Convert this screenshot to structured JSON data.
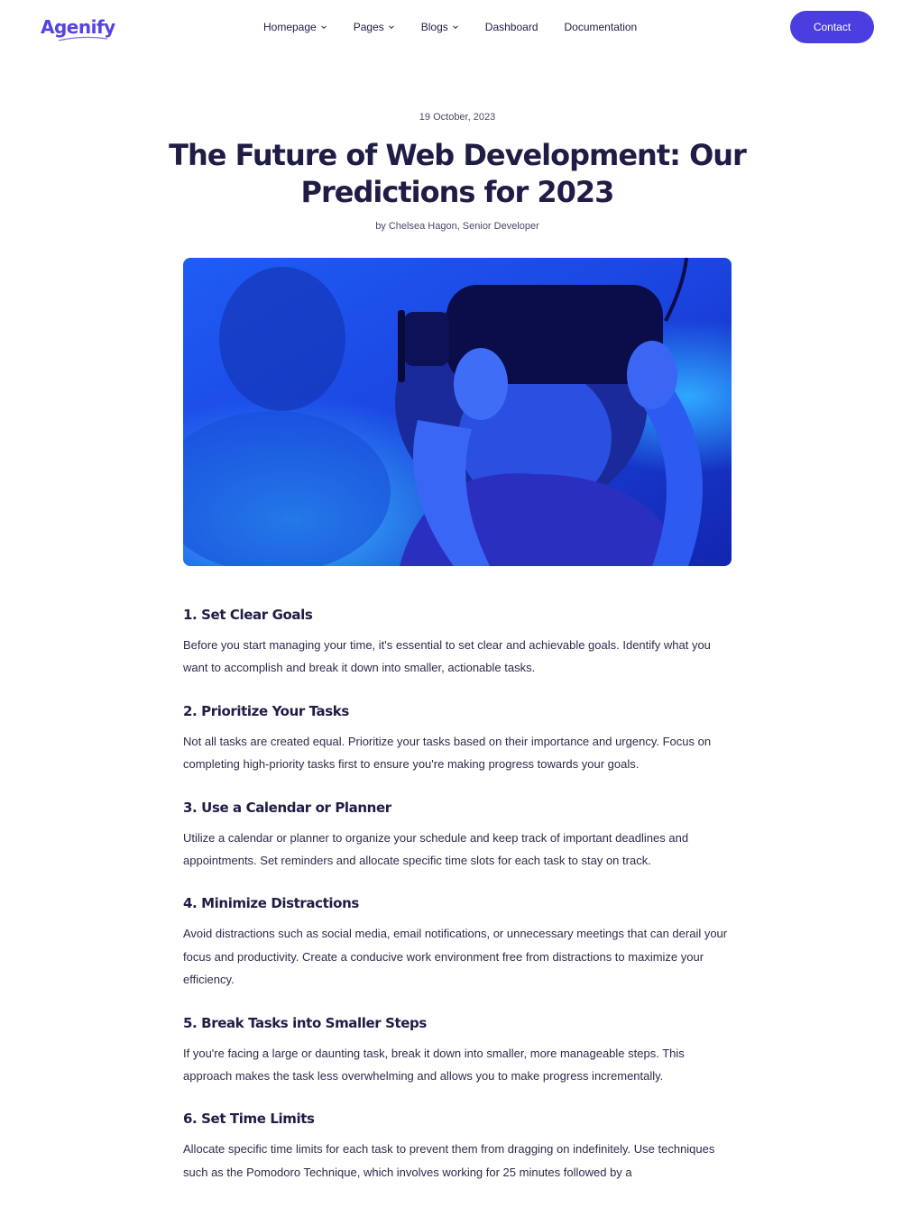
{
  "brand": {
    "name": "Agenify",
    "color": "#5444e3"
  },
  "nav": {
    "items": [
      {
        "label": "Homepage",
        "dropdown": true
      },
      {
        "label": "Pages",
        "dropdown": true
      },
      {
        "label": "Blogs",
        "dropdown": true
      },
      {
        "label": "Dashboard",
        "dropdown": false
      },
      {
        "label": "Documentation",
        "dropdown": false
      }
    ],
    "contact_label": "Contact"
  },
  "post": {
    "date": "19 October, 2023",
    "title": "The Future of Web Development: Our Predictions for 2023",
    "byline": "by Chelsea Hagon, Senior Developer",
    "sections": [
      {
        "heading": "1. Set Clear Goals",
        "body": "Before you start managing your time, it's essential to set clear and achievable goals. Identify what you want to accomplish and break it down into smaller, actionable tasks."
      },
      {
        "heading": "2. Prioritize Your Tasks",
        "body": "Not all tasks are created equal. Prioritize your tasks based on their importance and urgency. Focus on completing high-priority tasks first to ensure you're making progress towards your goals."
      },
      {
        "heading": "3. Use a Calendar or Planner",
        "body": "Utilize a calendar or planner to organize your schedule and keep track of important deadlines and appointments. Set reminders and allocate specific time slots for each task to stay on track."
      },
      {
        "heading": "4. Minimize Distractions",
        "body": "Avoid distractions such as social media, email notifications, or unnecessary meetings that can derail your focus and productivity. Create a conducive work environment free from distractions to maximize your efficiency."
      },
      {
        "heading": "5. Break Tasks into Smaller Steps",
        "body": "If you're facing a large or daunting task, break it down into smaller, more manageable steps. This approach makes the task less overwhelming and allows you to make progress incrementally."
      },
      {
        "heading": "6. Set Time Limits",
        "body": "Allocate specific time limits for each task to prevent them from dragging on indefinitely. Use techniques such as the Pomodoro Technique, which involves working for 25 minutes followed by a"
      }
    ]
  }
}
